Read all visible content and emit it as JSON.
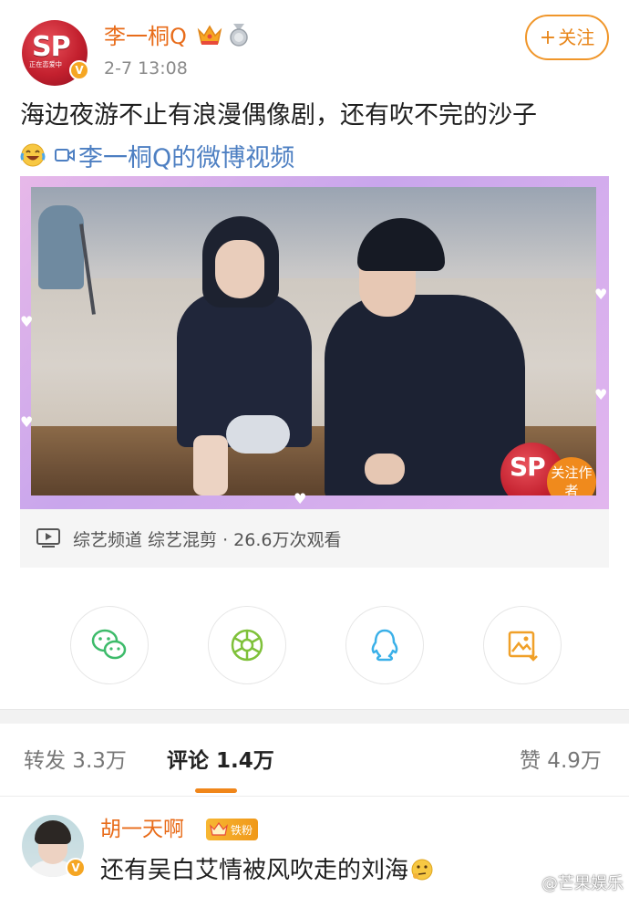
{
  "author": {
    "name": "李一桐Q",
    "time": "2-7 13:08",
    "avatar_text": "SP",
    "avatar_subtext": "正在恋爱中"
  },
  "follow_button": {
    "plus": "+",
    "label": "关注"
  },
  "post": {
    "text": "海边夜游不止有浪漫偶像剧，还有吹不完的沙子",
    "video_link": "李一桐Q的微博视频"
  },
  "video": {
    "overlay_sp": "SP",
    "overlay_follow": "关注作者",
    "meta": "综艺频道 综艺混剪 · 26.6万次观看"
  },
  "share_icons": [
    "wechat-icon",
    "moments-icon",
    "qq-icon",
    "save-image-icon"
  ],
  "tabs": {
    "repost": "转发 3.3万",
    "comment": "评论 1.4万",
    "like": "赞 4.9万"
  },
  "comment": {
    "name": "胡一天啊",
    "fan_badge": "铁粉",
    "text": "还有吴白艾情被风吹走的刘海"
  },
  "watermark": "@芒果娱乐",
  "colors": {
    "accent": "#f0861a",
    "username": "#e86c1a",
    "link": "#4d7fc2"
  }
}
